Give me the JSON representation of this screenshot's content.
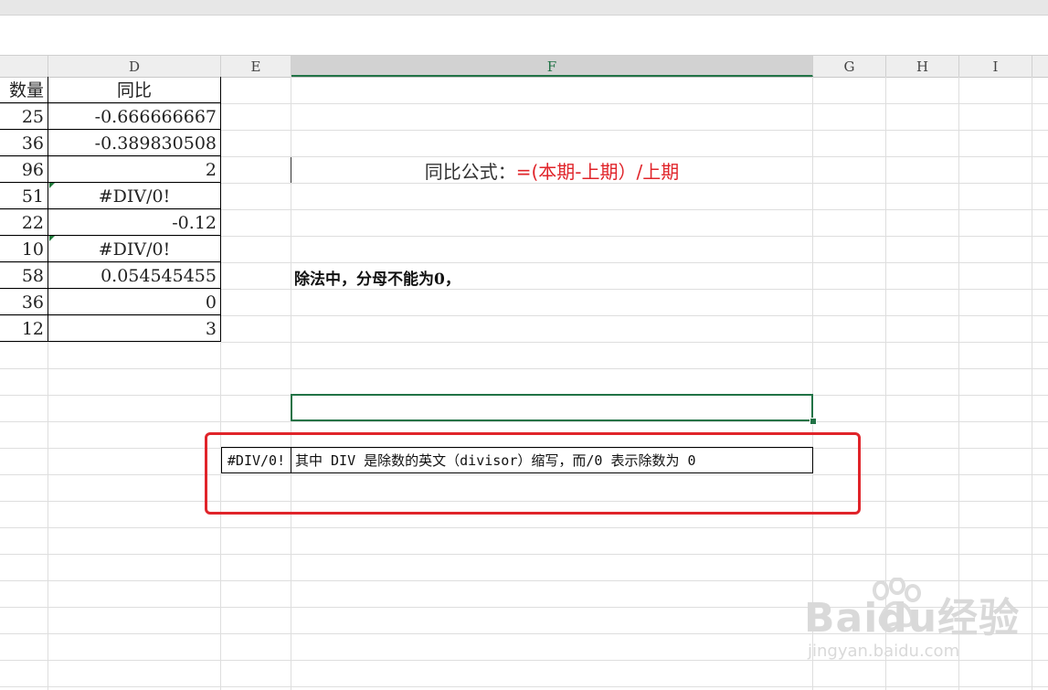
{
  "columns": [
    {
      "id": "c",
      "label": ""
    },
    {
      "id": "d",
      "label": "D"
    },
    {
      "id": "e",
      "label": "E"
    },
    {
      "id": "f",
      "label": "F"
    },
    {
      "id": "g",
      "label": "G"
    },
    {
      "id": "h",
      "label": "H"
    },
    {
      "id": "i",
      "label": "I"
    }
  ],
  "table": {
    "header_c": "数量",
    "header_d": "同比",
    "rows": [
      {
        "c": "25",
        "d": "-0.666666667"
      },
      {
        "c": "36",
        "d": "-0.389830508"
      },
      {
        "c": "96",
        "d": "2"
      },
      {
        "c": "51",
        "d": "#DIV/0!"
      },
      {
        "c": "22",
        "d": "-0.12"
      },
      {
        "c": "10",
        "d": "#DIV/0!"
      },
      {
        "c": "58",
        "d": "0.054545455"
      },
      {
        "c": "36",
        "d": "0"
      },
      {
        "c": "12",
        "d": "3"
      }
    ]
  },
  "formula": {
    "label": "同比公式：",
    "expression": "=(本期-上期）/上期"
  },
  "note": "除法中，分母不能为0，",
  "error_explanation": {
    "code": "#DIV/0!",
    "text": "其中 DIV 是除数的英文（divisor）缩写，而/0 表示除数为 0"
  },
  "watermark": {
    "brand": "Baidu经验",
    "url": "jingyan.baidu.com"
  },
  "colors": {
    "accent_green": "#217346",
    "highlight_red": "#e0242a"
  }
}
